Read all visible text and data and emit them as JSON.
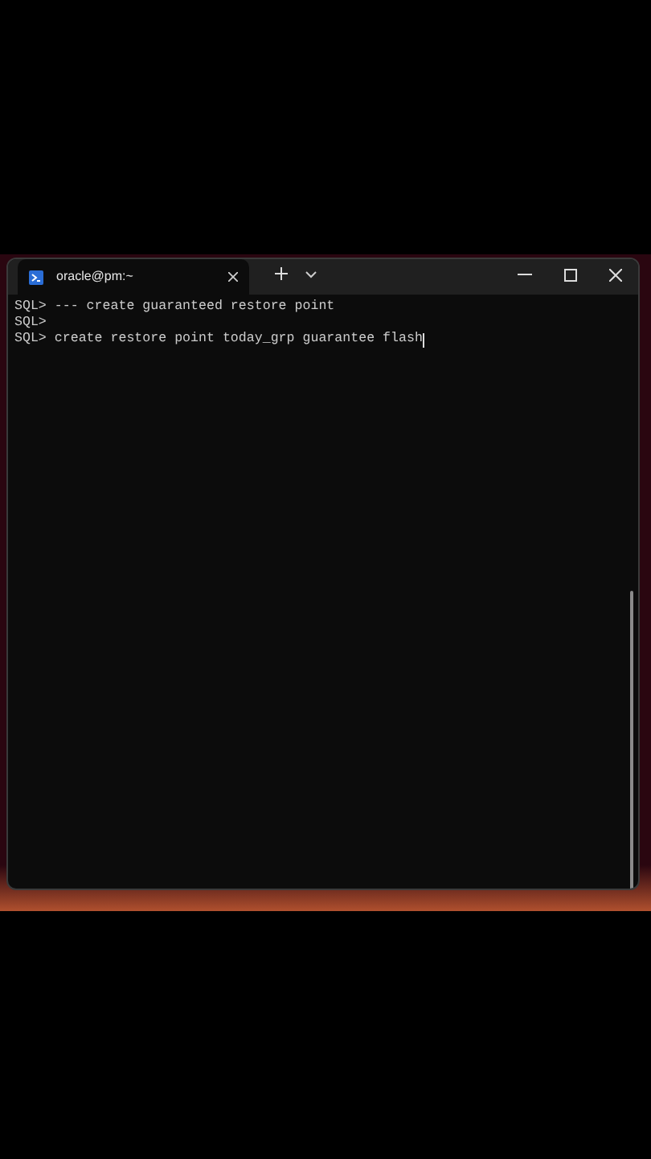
{
  "tabs": [
    {
      "title": "oracle@pm:~",
      "selected": true
    }
  ],
  "terminal": {
    "lines": [
      "SQL> --- create guaranteed restore point",
      "SQL>",
      "SQL> create restore point today_grp guarantee flash"
    ],
    "cursor": true
  }
}
